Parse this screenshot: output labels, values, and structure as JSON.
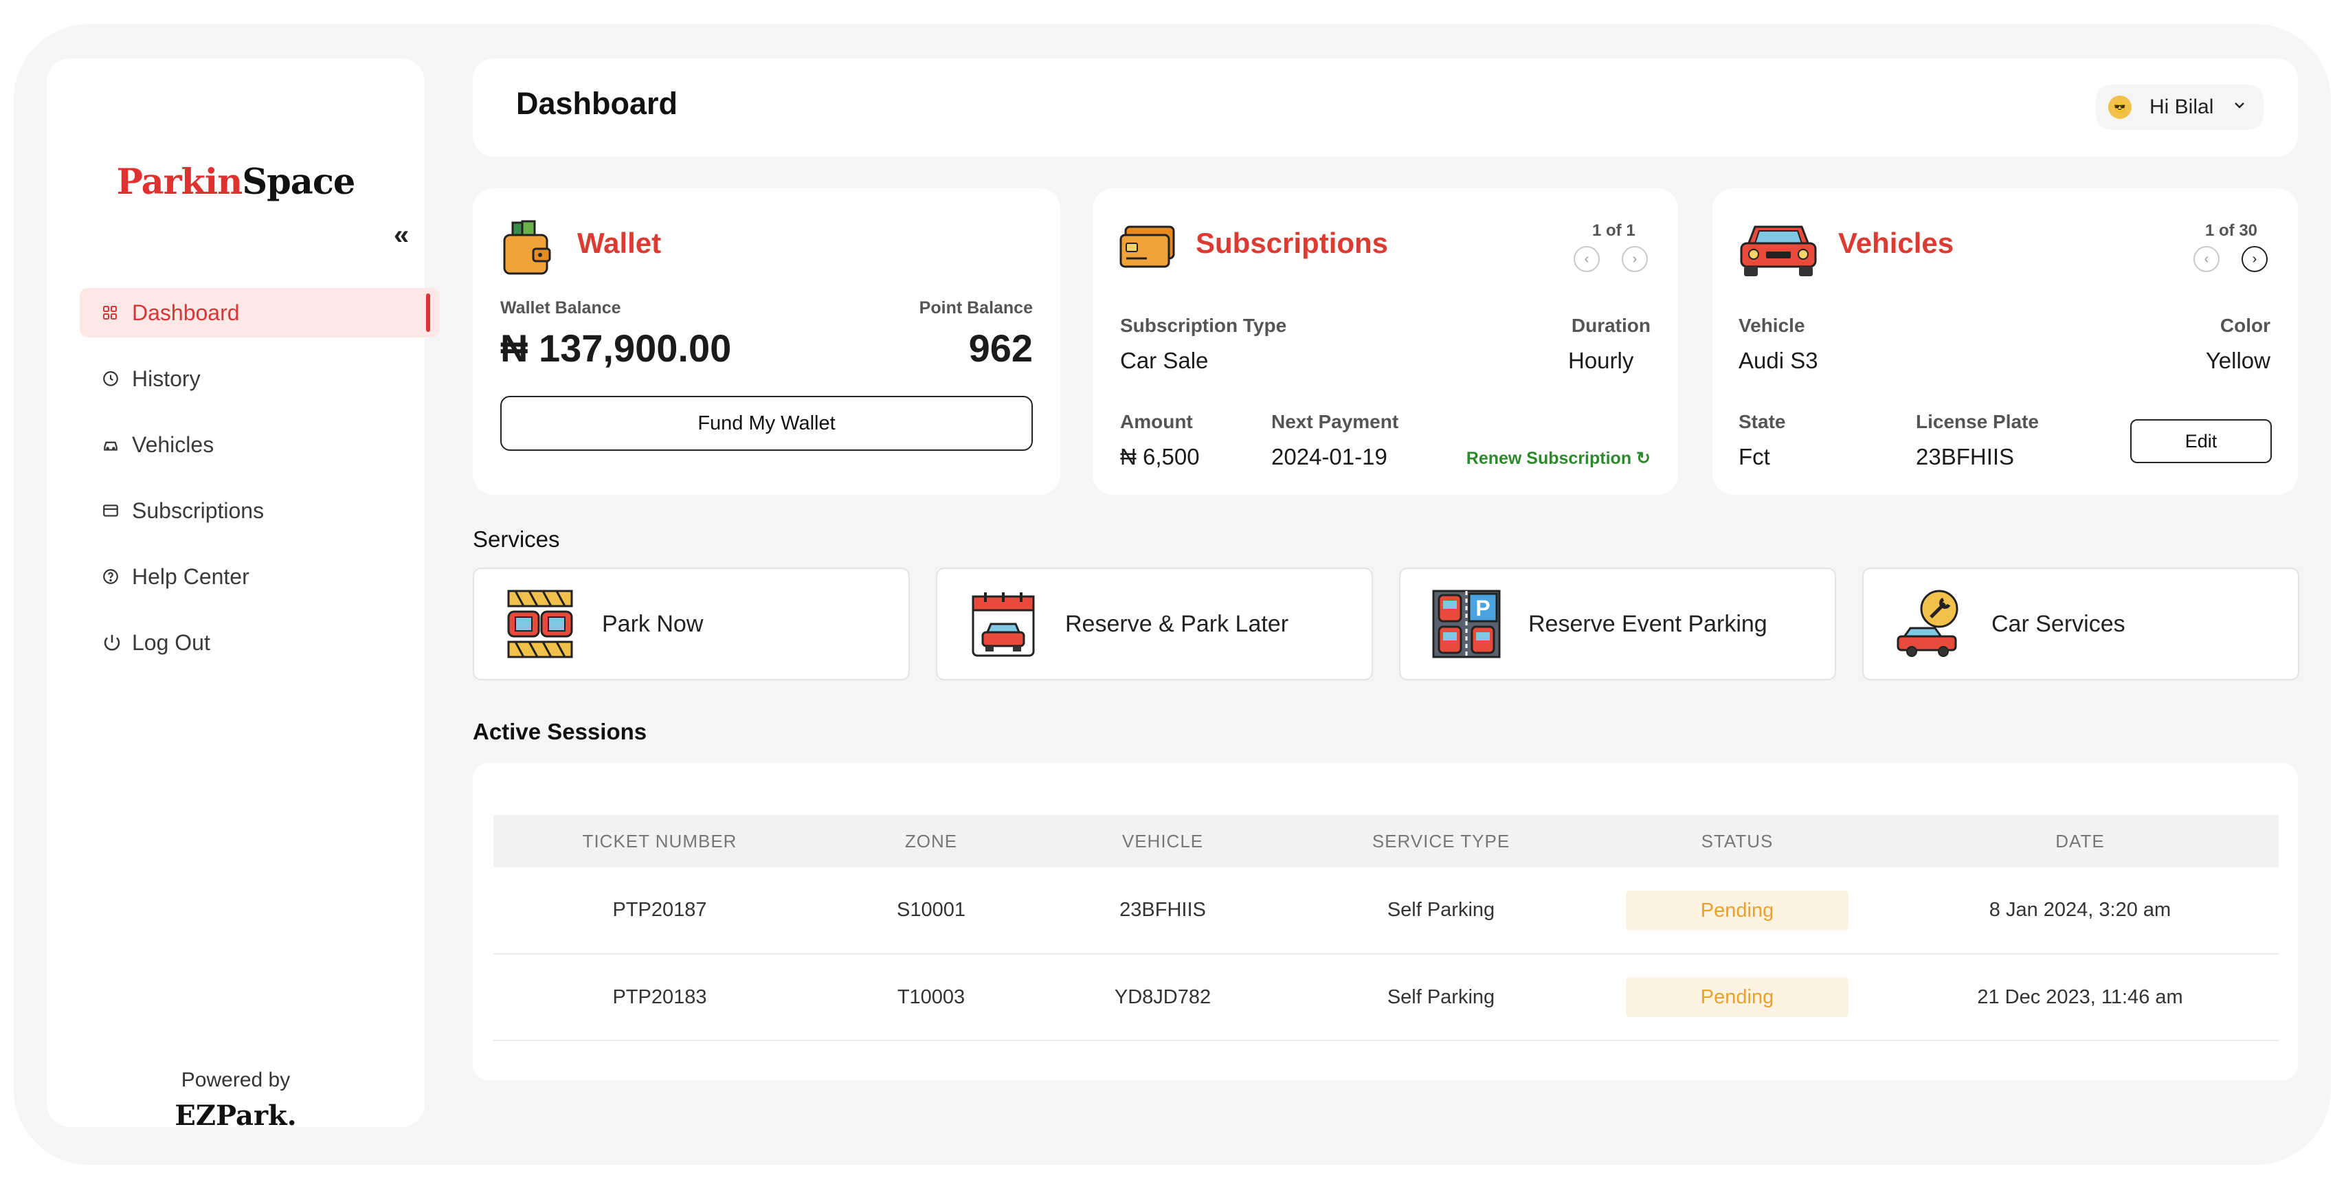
{
  "brand": {
    "part1": "Parkin",
    "part2": "Space"
  },
  "sidebar": {
    "collapse_label": "«",
    "items": [
      {
        "label": "Dashboard",
        "icon": "grid-icon",
        "active": true
      },
      {
        "label": "History",
        "icon": "clock-icon"
      },
      {
        "label": "Vehicles",
        "icon": "car-icon"
      },
      {
        "label": "Subscriptions",
        "icon": "card-icon"
      },
      {
        "label": "Help Center",
        "icon": "help-icon"
      },
      {
        "label": "Log Out",
        "icon": "power-icon"
      }
    ],
    "powered_by": "Powered by",
    "powered_brand": "EZPark."
  },
  "header": {
    "title": "Dashboard",
    "greeting": "Hi Bilal"
  },
  "wallet": {
    "title": "Wallet",
    "balance_label": "Wallet Balance",
    "balance": "₦ 137,900.00",
    "points_label": "Point Balance",
    "points": "962",
    "fund_button": "Fund My Wallet"
  },
  "subscriptions": {
    "title": "Subscriptions",
    "pager": "1 of 1",
    "type_label": "Subscription Type",
    "type": "Car Sale",
    "duration_label": "Duration",
    "duration": "Hourly",
    "amount_label": "Amount",
    "amount": "₦ 6,500",
    "next_payment_label": "Next Payment",
    "next_payment": "2024-01-19",
    "renew": "Renew Subscription"
  },
  "vehicles": {
    "title": "Vehicles",
    "pager": "1 of 30",
    "vehicle_label": "Vehicle",
    "vehicle": "Audi S3",
    "color_label": "Color",
    "color": "Yellow",
    "state_label": "State",
    "state": "Fct",
    "plate_label": "License Plate",
    "plate": "23BFHIIS",
    "edit_button": "Edit"
  },
  "services": {
    "title": "Services",
    "items": [
      {
        "label": "Park Now",
        "icon": "parking-lot-icon"
      },
      {
        "label": "Reserve & Park Later",
        "icon": "calendar-car-icon"
      },
      {
        "label": "Reserve Event Parking",
        "icon": "parking-sign-icon"
      },
      {
        "label": "Car Services",
        "icon": "car-wrench-icon"
      }
    ]
  },
  "sessions": {
    "title": "Active Sessions",
    "columns": [
      "TICKET NUMBER",
      "ZONE",
      "VEHICLE",
      "SERVICE TYPE",
      "STATUS",
      "DATE"
    ],
    "rows": [
      [
        "PTP20187",
        "S10001",
        "23BFHIIS",
        "Self Parking",
        "Pending",
        "8 Jan 2024, 3:20 am"
      ],
      [
        "PTP20183",
        "T10003",
        "YD8JD782",
        "Self Parking",
        "Pending",
        "21 Dec 2023, 11:46 am"
      ]
    ]
  },
  "colors": {
    "accent": "#dc3b34",
    "active_bg": "#fde8e8",
    "pending_text": "#e8a12f",
    "pending_bg": "#fdf3e3",
    "renew": "#2c8a2c",
    "background": "#f4f5f7"
  }
}
